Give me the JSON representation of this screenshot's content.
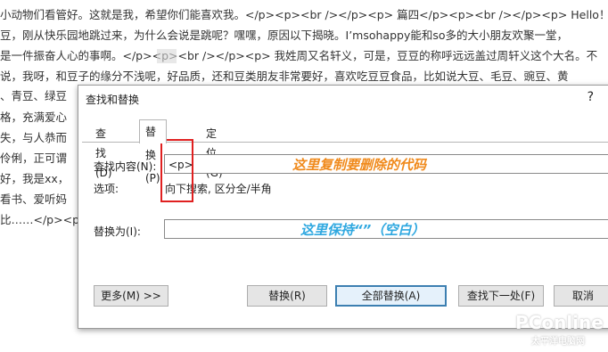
{
  "document": {
    "lines": [
      "小动物们看管好。这就是我，希望你们能喜欢我。</p><p><br /></p><p>        篇四</p><p><br /></p><p>        Hello！我",
      "豆，刚从快乐园地跳过来，为什么会说是跳呢？嘿嘿，原因以下揭晓。I’msohappy能和so多的大小朋友欢聚一堂，",
      "是一件振奋人心的事啊。</p><p><br /></p><p>        我姓周又名轩义，可是，豆豆的称呼远远盖过周轩义这个大名。不",
      "说，我呀，和豆子的缘分不浅呢，好品质，还和豆类朋友非常要好，喜欢吃豆豆食品，比如说大豆、毛豆、豌豆、黄",
      "、青豆、绿豆",
      "格，充满爱心",
      "失，与人恭而",
      "伶俐，正可谓",
      "好，我是xx，",
      "看书、爱听妈",
      "比……</p><p"
    ],
    "highlight_text": "</p>"
  },
  "dialog": {
    "title": "查找和替换",
    "help": "?",
    "tabs": [
      "查找(D)",
      "替换(P)",
      "定位(G)"
    ],
    "find_label": "查找内容(N):",
    "find_value": "<p>",
    "options_label": "选项:",
    "options_value": "向下搜索, 区分全/半角",
    "replace_label": "替换为(I):",
    "replace_value": "",
    "buttons": {
      "more": "更多(M) >>",
      "replace": "替换(R)",
      "replace_all": "全部替换(A)",
      "find_next": "查找下一处(F)",
      "cancel": "取消"
    }
  },
  "annotations": {
    "copy_code": "这里复制要删除的代码",
    "keep_blank": "这里保持“”（空白）"
  },
  "watermark": {
    "logo": "PConline",
    "sub": "太平洋电脑网"
  },
  "colors": {
    "annotation_orange": "#f08a1c",
    "annotation_blue": "#2fa8e0",
    "red_box": "#e02020",
    "primary_button_border": "#3c7fb1"
  }
}
